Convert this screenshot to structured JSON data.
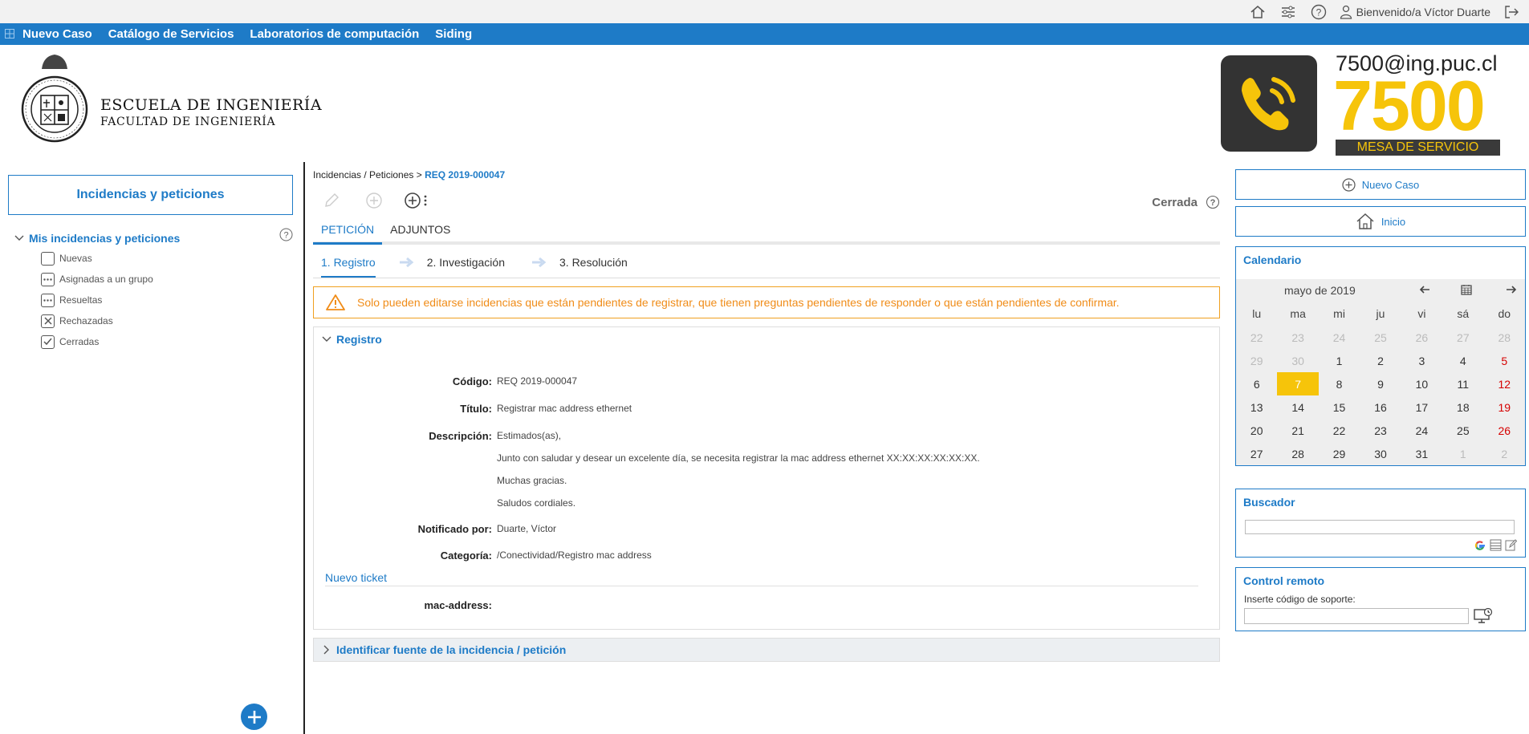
{
  "topbar": {
    "welcome": "Bienvenido/a Víctor Duarte",
    "icons": [
      "home-icon",
      "sliders-icon",
      "help-icon",
      "user-icon",
      "logout-icon"
    ]
  },
  "nav": {
    "items": [
      "Nuevo Caso",
      "Catálogo de Servicios",
      "Laboratorios de computación",
      "Siding"
    ]
  },
  "header": {
    "logo_line1": "ESCUELA DE INGENIERÍA",
    "logo_line2": "FACULTAD DE INGENIERÍA",
    "brand_email": "7500@ing.puc.cl",
    "brand_number": "7500",
    "brand_tagline": "MESA DE SERVICIO"
  },
  "left": {
    "title": "Incidencias y peticiones",
    "tree_head": "Mis incidencias y peticiones",
    "items": [
      {
        "label": "Nuevas",
        "icon": "empty-box-icon"
      },
      {
        "label": "Asignadas a un grupo",
        "icon": "dots-box-icon"
      },
      {
        "label": "Resueltas",
        "icon": "dots-box-icon"
      },
      {
        "label": "Rechazadas",
        "icon": "x-box-icon"
      },
      {
        "label": "Cerradas",
        "icon": "check-box-icon"
      }
    ]
  },
  "center": {
    "breadcrumb_prefix": "Incidencias / Peticiones > ",
    "breadcrumb_current": "REQ 2019-000047",
    "status": "Cerrada",
    "tabs": [
      "PETICIÓN",
      "ADJUNTOS"
    ],
    "steps": [
      "1. Registro",
      "2. Investigación",
      "3. Resolución"
    ],
    "warning": "Solo pueden editarse incidencias que están pendientes de registrar, que tienen preguntas pendientes de responder o que están pendientes de confirmar.",
    "section_title": "Registro",
    "fields": {
      "codigo_k": "Código:",
      "codigo_v": "REQ 2019-000047",
      "titulo_k": "Título:",
      "titulo_v": "Registrar mac address ethernet",
      "desc_k": "Descripción:",
      "desc_lines": [
        "Estimados(as),",
        "Junto con saludar y desear un excelente día, se necesita registrar la mac address ethernet XX:XX:XX:XX:XX:XX.",
        "Muchas gracias.",
        "Saludos cordiales."
      ],
      "notif_k": "Notificado por:",
      "notif_v": "Duarte, Víctor",
      "cat_k": "Categoría:",
      "cat_v": "/Conectividad/Registro mac address"
    },
    "subsection": "Nuevo ticket",
    "mac_k": "mac-address:",
    "section2_title": "Identificar fuente de la incidencia / petición"
  },
  "right": {
    "nuevo_caso": "Nuevo Caso",
    "inicio": "Inicio",
    "calendar": {
      "title": "Calendario",
      "month": "mayo de 2019",
      "weekdays": [
        "lu",
        "ma",
        "mi",
        "ju",
        "vi",
        "sá",
        "do"
      ],
      "weeks": [
        [
          "22",
          "23",
          "24",
          "25",
          "26",
          "27",
          "28"
        ],
        [
          "29",
          "30",
          "1",
          "2",
          "3",
          "4",
          "5"
        ],
        [
          "6",
          "7",
          "8",
          "9",
          "10",
          "11",
          "12"
        ],
        [
          "13",
          "14",
          "15",
          "16",
          "17",
          "18",
          "19"
        ],
        [
          "20",
          "21",
          "22",
          "23",
          "24",
          "25",
          "26"
        ],
        [
          "27",
          "28",
          "29",
          "30",
          "31",
          "1",
          "2"
        ]
      ],
      "today": "7"
    },
    "buscador_title": "Buscador",
    "control_title": "Control remoto",
    "control_label": "Inserte código de soporte:"
  },
  "colors": {
    "primary": "#1e7bc7",
    "brand_yellow": "#f6c40a",
    "warning": "#f08c18",
    "sunday": "#d60000"
  }
}
